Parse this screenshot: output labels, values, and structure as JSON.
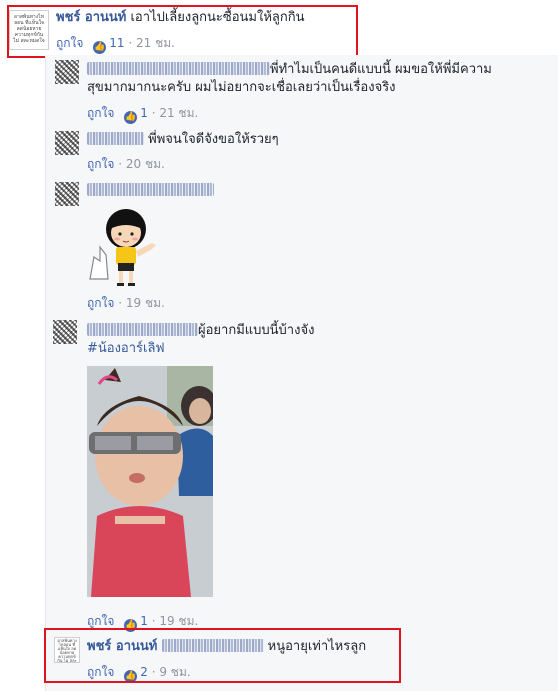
{
  "top_comment": {
    "author": "พชร์ อานนท์",
    "text": " เอาไปเลี้ยงลูกนะซื้อนมให้ลูกกิน",
    "like_label": "ถูกใจ",
    "reaction_count": "11",
    "time": "21 ชม.",
    "avatar_text": "อาสพ้นทางไหลอน ที่เเห็นใจ ลดน้อยหายความทุกข์กัน ไม่ สละหมดใจ"
  },
  "replies": [
    {
      "text": "พี่ทำไมเป็นคนดีแบบนี้ ผมขอให้พี่มีความสุขมากมากนะครับ ผมไม่อยากจะเชื่อเลยว่าเป็นเรื่องจริง",
      "line1": "พี่ทำไมเป็นคนดีแบบนี้ ผมขอให้พี่มีความ",
      "line2": "สุขมากมากนะครับ ผมไม่อยากจะเชื่อเลยว่าเป็นเรื่องจริง",
      "like_label": "ถูกใจ",
      "reaction_count": "1",
      "time": "21 ชม."
    },
    {
      "text": "พี่พจนใจดีจังขอให้รวยๆ",
      "like_label": "ถูกใจ",
      "time": "20 ชม."
    },
    {
      "like_label": "ถูกใจ",
      "time": "19 ชม."
    },
    {
      "text": "ผู้อยากมีแบบนี้บ้างจัง",
      "hashtag": "#น้องอาร์เลิฟ",
      "like_label": "ถูกใจ",
      "reaction_count": "1",
      "time": "19 ชม."
    },
    {
      "author": "พชร์ อานนท์",
      "text": "หนูอายุเท่าไหรลูก",
      "like_label": "ถูกใจ",
      "reaction_count": "2",
      "time": "9 ชม."
    }
  ],
  "colors": {
    "highlight_box": "#e0131e",
    "link": "#365899",
    "like_blue": "#4267b2",
    "meta_gray": "#90949c"
  },
  "icons": [
    "like-thumb-icon"
  ]
}
